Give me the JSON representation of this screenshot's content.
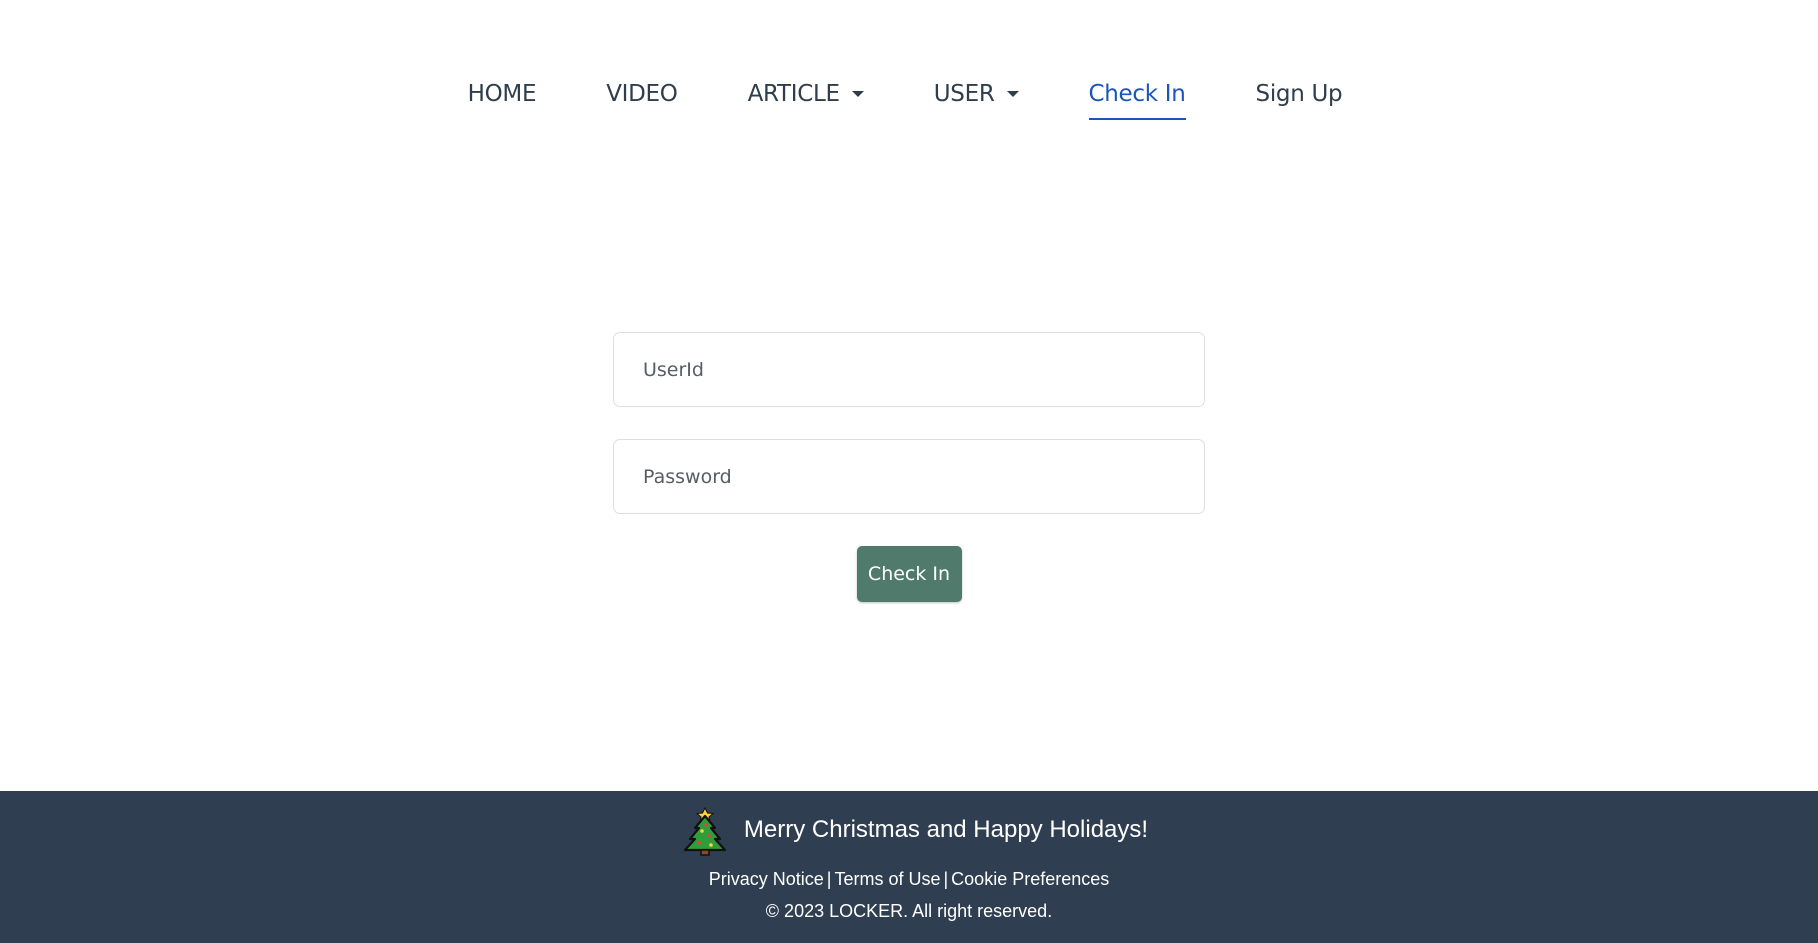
{
  "nav": {
    "items": [
      {
        "label": "HOME",
        "dropdown": false,
        "active": false
      },
      {
        "label": "VIDEO",
        "dropdown": false,
        "active": false
      },
      {
        "label": "ARTICLE",
        "dropdown": true,
        "active": false
      },
      {
        "label": "USER",
        "dropdown": true,
        "active": false
      },
      {
        "label": "Check In",
        "dropdown": false,
        "active": true
      },
      {
        "label": "Sign Up",
        "dropdown": false,
        "active": false
      }
    ],
    "active_color": "#1c55b8"
  },
  "form": {
    "userid_placeholder": "UserId",
    "password_placeholder": "Password",
    "submit_label": "Check In",
    "button_color": "#4f7a6c"
  },
  "footer": {
    "icon": "christmas-tree-icon",
    "greeting": "Merry Christmas and Happy Holidays!",
    "links": {
      "privacy": "Privacy Notice",
      "terms": "Terms of Use",
      "cookies": "Cookie Preferences",
      "separator": "|"
    },
    "copyright": "© 2023 LOCKER. All right reserved.",
    "background": "#2f3e50"
  }
}
